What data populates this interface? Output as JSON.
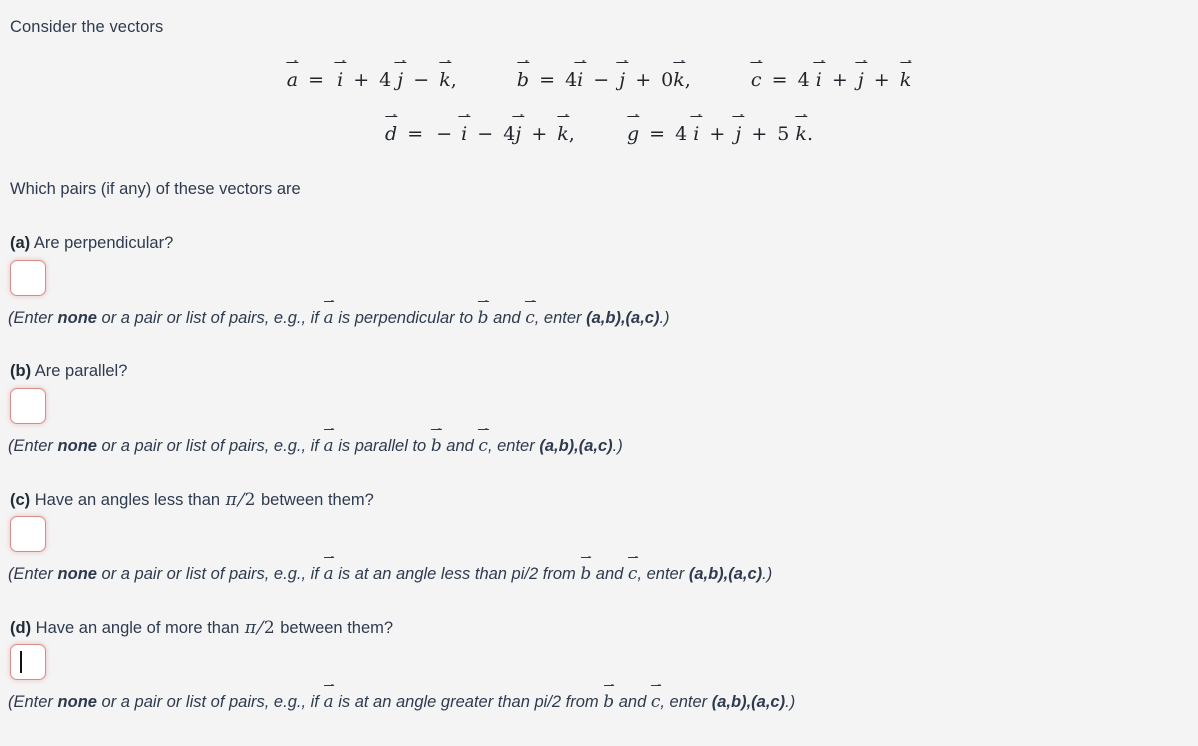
{
  "page": {
    "background": "#f4f4f4",
    "text_color": "#2e3b4e",
    "input_border_color": "#d98b8b"
  },
  "intro": "Consider the vectors",
  "equations": {
    "line1": [
      {
        "lhs": "a",
        "terms": "i + 4 j − k,"
      },
      {
        "lhs": "b",
        "terms": "4 i − j + 0 k,"
      },
      {
        "lhs": "c",
        "terms": "4 i + j + k"
      }
    ],
    "line2": [
      {
        "lhs": "d",
        "terms": "− i − 4 j + k,"
      },
      {
        "lhs": "g",
        "terms": "4 i + j + 5 k."
      }
    ],
    "symbols": {
      "a": "a",
      "b": "b",
      "c": "c",
      "d": "d",
      "g": "g",
      "i": "i",
      "j": "j",
      "k": "k",
      "equals": "=",
      "plus": "+",
      "minus": "−",
      "comma": ",",
      "period": ".",
      "four": "4",
      "five": "5",
      "zero": "0"
    }
  },
  "question": "Which pairs (if any) of these vectors are",
  "parts": [
    {
      "id": "a",
      "label": "(a)",
      "text": "Are perpendicular?",
      "value": "",
      "focused": false,
      "hint": {
        "open": "(Enter ",
        "none": "none",
        "mid1": " or a pair or list of pairs, e.g., if ",
        "vec1": "a",
        "mid2": " is perpendicular to ",
        "vec2": "b",
        "mid3": " and ",
        "vec3": "c",
        "mid4": ", enter ",
        "pairs": "(a,b),(a,c)",
        "close": ".)"
      }
    },
    {
      "id": "b",
      "label": "(b)",
      "text": "Are parallel?",
      "value": "",
      "focused": false,
      "hint": {
        "open": "(Enter ",
        "none": "none",
        "mid1": " or a pair or list of pairs, e.g., if ",
        "vec1": "a",
        "mid2": " is parallel to ",
        "vec2": "b",
        "mid3": " and ",
        "vec3": "c",
        "mid4": ", enter ",
        "pairs": "(a,b),(a,c)",
        "close": ".)"
      }
    },
    {
      "id": "c",
      "label": "(c)",
      "text_before": "Have an angles less than ",
      "pi_over_2": "π/2",
      "text_after": " between them?",
      "value": "",
      "focused": false,
      "hint": {
        "open": "(Enter ",
        "none": "none",
        "mid1": " or a pair or list of pairs, e.g., if ",
        "vec1": "a",
        "mid2": " is at an angle less than pi/2 from ",
        "vec2": "b",
        "mid3": " and ",
        "vec3": "c",
        "mid4": ", enter ",
        "pairs": "(a,b),(a,c)",
        "close": ".)"
      }
    },
    {
      "id": "d",
      "label": "(d)",
      "text_before": "Have an angle of more than ",
      "pi_over_2": "π/2",
      "text_after": " between them?",
      "value": "",
      "focused": true,
      "hint": {
        "open": "(Enter ",
        "none": "none",
        "mid1": " or a pair or list of pairs, e.g., if ",
        "vec1": "a",
        "mid2": " is at an angle greater than pi/2 from ",
        "vec2": "b",
        "mid3": " and ",
        "vec3": "c",
        "mid4": ", enter ",
        "pairs": "(a,b),(a,c)",
        "close": ".)"
      }
    }
  ]
}
